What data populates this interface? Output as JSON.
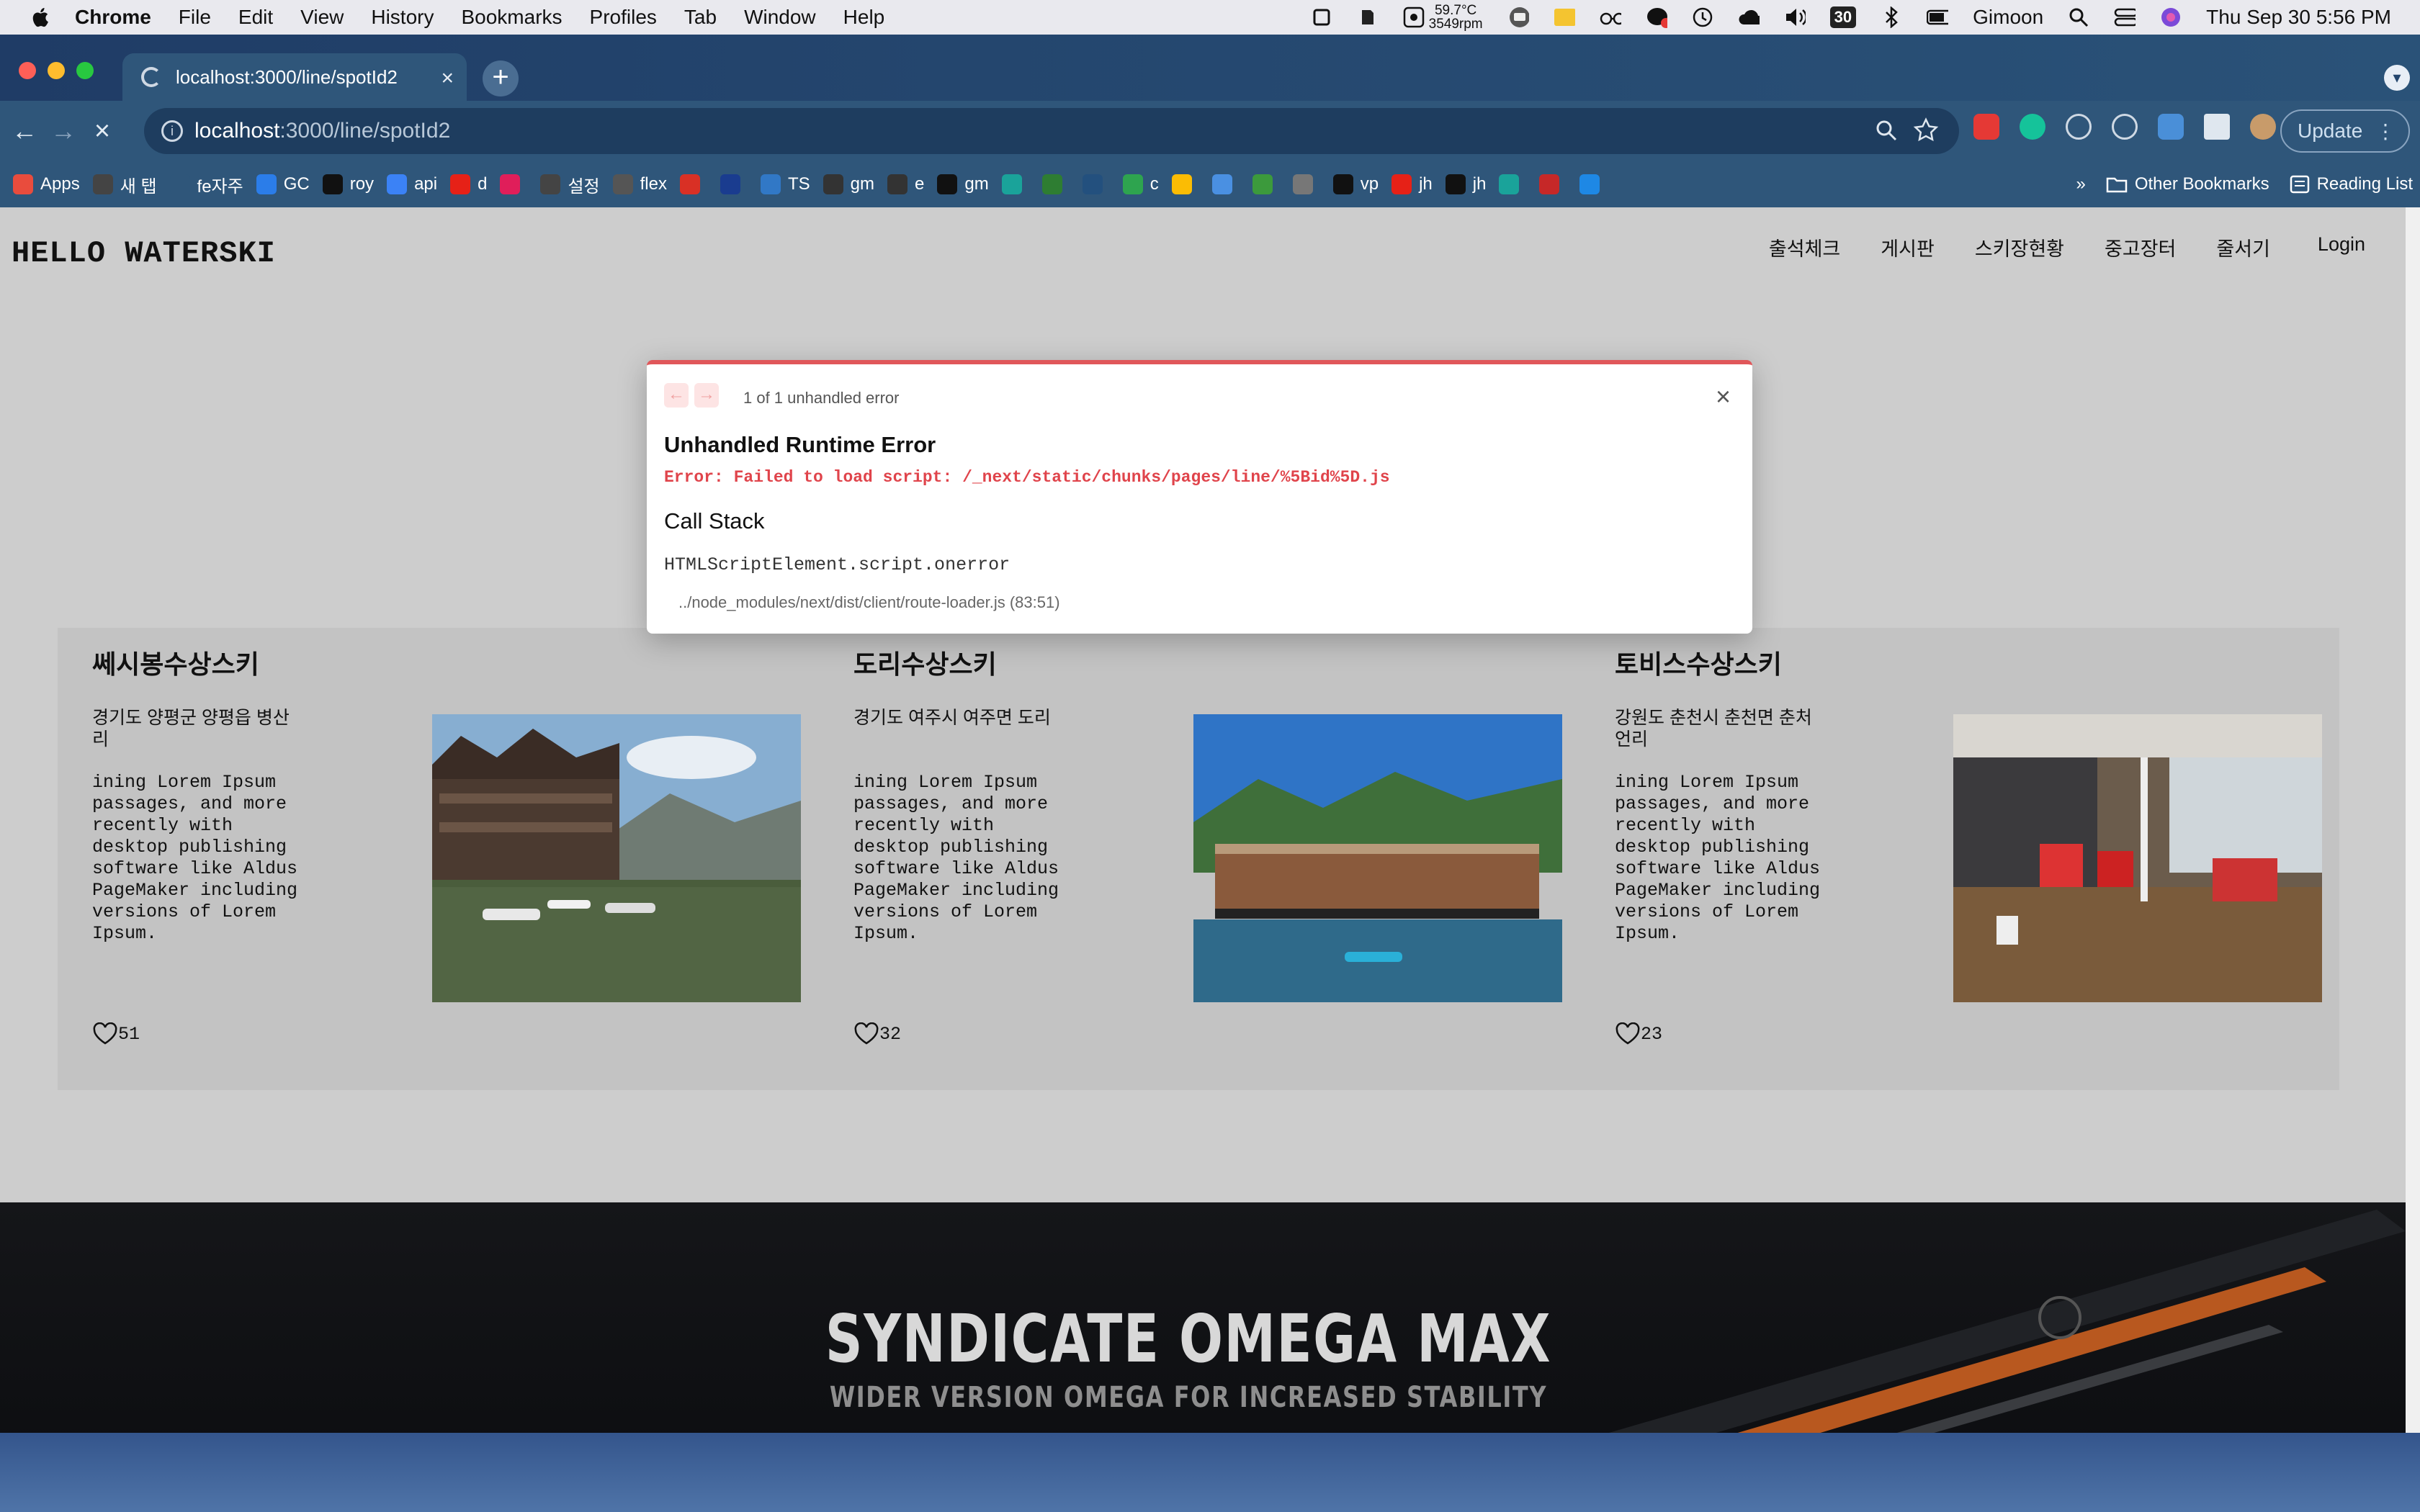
{
  "menubar": {
    "app": "Chrome",
    "items": [
      "File",
      "Edit",
      "View",
      "History",
      "Bookmarks",
      "Profiles",
      "Tab",
      "Window",
      "Help"
    ],
    "temp_top": "59.7°C",
    "temp_bottom": "3549rpm",
    "calendar_day": "30",
    "user": "Gimoon",
    "datetime": "Thu Sep 30  5:56 PM"
  },
  "browser": {
    "tab_title": "localhost:3000/line/spotId2",
    "url_host": "localhost",
    "url_path": ":3000/line/spotId2",
    "update_label": "Update",
    "bookmarks": [
      {
        "label": "Apps",
        "color": "#e94c3d"
      },
      {
        "label": "새 탭",
        "color": "#444444"
      },
      {
        "label": "fe자주",
        "color": "#2f567a"
      },
      {
        "label": "GC",
        "color": "#2b7de9"
      },
      {
        "label": "roy",
        "color": "#111111"
      },
      {
        "label": "api",
        "color": "#3b82f6"
      },
      {
        "label": "d",
        "color": "#e62117"
      },
      {
        "label": "",
        "color": "#e01e5a"
      },
      {
        "label": "설정",
        "color": "#444444"
      },
      {
        "label": "flex",
        "color": "#555555"
      },
      {
        "label": "",
        "color": "#d93025"
      },
      {
        "label": "",
        "color": "#1a3c8f"
      },
      {
        "label": "TS",
        "color": "#3178c6"
      },
      {
        "label": "gm",
        "color": "#333333"
      },
      {
        "label": "e",
        "color": "#333333"
      },
      {
        "label": "gm",
        "color": "#111111"
      },
      {
        "label": "",
        "color": "#1aa39a"
      },
      {
        "label": "",
        "color": "#2e7d32"
      },
      {
        "label": "",
        "color": "#23507e"
      },
      {
        "label": "c",
        "color": "#2ea44f"
      },
      {
        "label": "",
        "color": "#fbbc04"
      },
      {
        "label": "",
        "color": "#4a90e2"
      },
      {
        "label": "",
        "color": "#3c9a3c"
      },
      {
        "label": "",
        "color": "#777777"
      },
      {
        "label": "vp",
        "color": "#111111"
      },
      {
        "label": "jh",
        "color": "#e62117"
      },
      {
        "label": "jh",
        "color": "#111111"
      },
      {
        "label": "",
        "color": "#1aa39a"
      },
      {
        "label": "",
        "color": "#c62828"
      },
      {
        "label": "",
        "color": "#1e88e5"
      }
    ],
    "bookmarks_more": "»",
    "other_bookmarks": "Other Bookmarks",
    "reading_list": "Reading List"
  },
  "site": {
    "brand": "HELLO WATERSKI",
    "nav": [
      "출석체크",
      "게시판",
      "스키장현황",
      "중고장터",
      "줄서기"
    ],
    "login": "Login"
  },
  "cards": [
    {
      "name": "쎄시봉수상스키",
      "address": "경기도 양평군 양평읍 병산리",
      "description": "ining Lorem Ipsum passages, and more recently with desktop publishing software like Aldus PageMaker including versions of Lorem Ipsum.",
      "likes": "51"
    },
    {
      "name": "도리수상스키",
      "address": "경기도 여주시 여주면 도리",
      "description": "ining Lorem Ipsum passages, and more recently with desktop publishing software like Aldus PageMaker including versions of Lorem Ipsum.",
      "likes": "32"
    },
    {
      "name": "토비스수상스키",
      "address": "강원도 춘천시 춘천면 춘처언리",
      "description": "ining Lorem Ipsum passages, and more recently with desktop publishing software like Aldus PageMaker including versions of Lorem Ipsum.",
      "likes": "23"
    }
  ],
  "error_overlay": {
    "count": "1 of 1 unhandled error",
    "title": "Unhandled Runtime Error",
    "message": "Error: Failed to load script: /_next/static/chunks/pages/line/%5Bid%5D.js",
    "call_stack_title": "Call Stack",
    "frame": "HTMLScriptElement.script.onerror",
    "file": "../node_modules/next/dist/client/route-loader.js (83:51)"
  },
  "banner": {
    "title": "SYNDICATE OMEGA MAX",
    "subtitle": "WIDER VERSION OMEGA FOR INCREASED STABILITY"
  }
}
